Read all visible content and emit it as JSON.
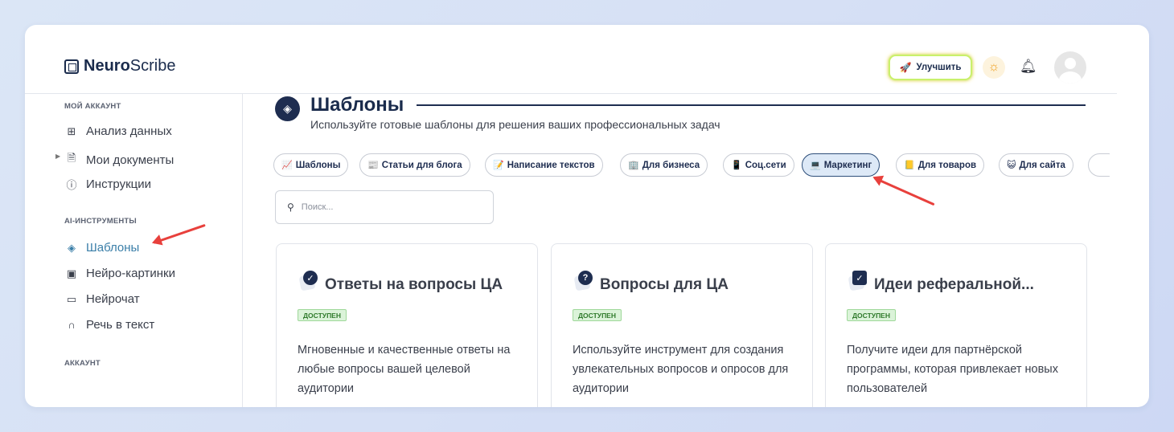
{
  "header": {
    "logo_bold": "Neuro",
    "logo_rest": "Scribe",
    "upgrade_label": "Улучшить"
  },
  "sidebar": {
    "section_account": "МОЙ АККАУНТ",
    "items_account": [
      {
        "label": "Анализ данных",
        "icon": "grid-icon"
      },
      {
        "label": "Мои документы",
        "icon": "document-icon"
      },
      {
        "label": "Инструкции",
        "icon": "help-icon"
      }
    ],
    "section_ai": "AI-ИНСТРУМЕНТЫ",
    "items_ai": [
      {
        "label": "Шаблоны",
        "icon": "layers-icon",
        "active": true
      },
      {
        "label": "Нейро-картинки",
        "icon": "image-icon"
      },
      {
        "label": "Нейрочат",
        "icon": "chat-icon"
      },
      {
        "label": "Речь в текст",
        "icon": "headphones-icon"
      }
    ],
    "section_profile": "АККАУНТ"
  },
  "main": {
    "title": "Шаблоны",
    "subtitle": "Используйте готовые шаблоны для решения ваших профессиональных задач",
    "chips": [
      {
        "label": "Шаблоны",
        "icon": "📈"
      },
      {
        "label": "Статьи для блога",
        "icon": "📰"
      },
      {
        "label": "Написание текстов",
        "icon": "📝"
      },
      {
        "label": "Для бизнеса",
        "icon": "🏢"
      },
      {
        "label": "Соц.сети",
        "icon": "📱"
      },
      {
        "label": "Маркетинг",
        "icon": "💻",
        "active": true
      },
      {
        "label": "Для товаров",
        "icon": "📒"
      },
      {
        "label": "Для сайта",
        "icon": "😺"
      }
    ],
    "search_placeholder": "Поиск...",
    "cards": [
      {
        "title": "Ответы на вопросы ЦА",
        "badge": "ДОСТУПЕН",
        "desc": "Мгновенные и качественные ответы на любые вопросы вашей целевой аудитории",
        "icon": "check-circle-icon"
      },
      {
        "title": "Вопросы для ЦА",
        "badge": "ДОСТУПЕН",
        "desc": "Используйте инструмент для создания увлекательных вопросов и опросов для аудитории",
        "icon": "question-circle-icon"
      },
      {
        "title": "Идеи реферальной...",
        "badge": "ДОСТУПЕН",
        "desc": "Получите идеи для партнёрской программы, которая привлекает новых пользователей",
        "icon": "check-square-icon"
      }
    ]
  },
  "colors": {
    "accent": "#1e2d50",
    "active_link": "#3a7ea8",
    "badge_bg": "#dbf3d9",
    "arrow": "#e8403c"
  }
}
